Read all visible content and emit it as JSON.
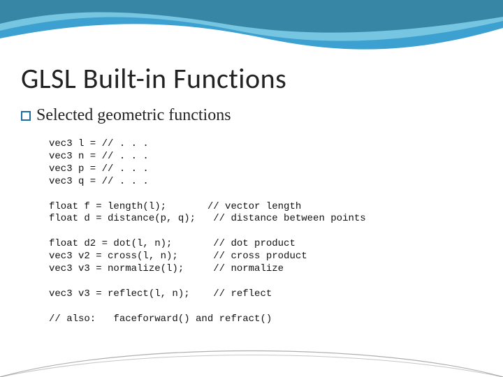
{
  "slide": {
    "title": "GLSL Built-in Functions",
    "subtitle": "Selected geometric functions",
    "code": "vec3 l = // . . .\nvec3 n = // . . .\nvec3 p = // . . .\nvec3 q = // . . .\n\nfloat f = length(l);       // vector length\nfloat d = distance(p, q);   // distance between points\n\nfloat d2 = dot(l, n);       // dot product\nvec3 v2 = cross(l, n);      // cross product\nvec3 v3 = normalize(l);     // normalize\n\nvec3 v3 = reflect(l, n);    // reflect\n\n// also:   faceforward() and refract()"
  },
  "theme": {
    "accent": "#1a8fc8",
    "accent_light": "#8fd4e8",
    "accent_dark": "#0d5b7f"
  }
}
